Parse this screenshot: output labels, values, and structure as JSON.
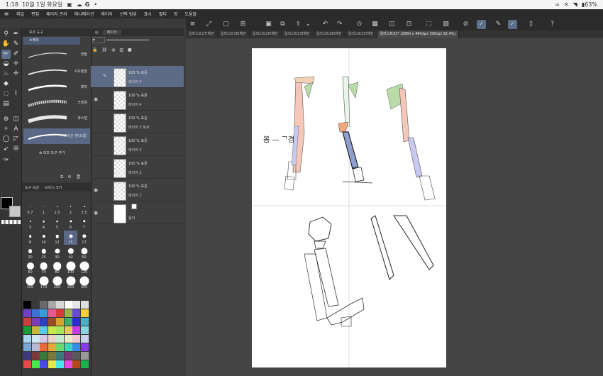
{
  "status": {
    "time": "1:18",
    "date": "10월 1일 화요일",
    "battery": "63%"
  },
  "menu": [
    "파일",
    "편집",
    "페이지 관리",
    "애니메이션",
    "레이어",
    "선택 범위",
    "표시",
    "필터",
    "창",
    "도움말"
  ],
  "brush_panel": {
    "tab": "보조 도구",
    "header": "스케치",
    "brushes": [
      {
        "label": "연필"
      },
      {
        "label": "샤프펜슬"
      },
      {
        "label": "매직"
      },
      {
        "label": "크레용"
      },
      {
        "label": "파스텔"
      },
      {
        "label": "초크"
      },
      {
        "label": "부드러운 펜(흐름)"
      }
    ],
    "add_sub_tool": "보조 도구 추가"
  },
  "size_panel": {
    "tabs": [
      "도구 속성",
      "브러시 크기"
    ],
    "sizes": [
      "0.7",
      "1",
      "1.5",
      "2",
      "2.5",
      "3",
      "4",
      "5",
      "6",
      "7",
      "8",
      "10",
      "12",
      "15",
      "17",
      "20",
      "25",
      "30",
      "40",
      "50",
      "60",
      "70",
      "80",
      "100",
      "120",
      "150",
      "170",
      "200",
      "250",
      "300"
    ],
    "selected": "15"
  },
  "palette_colors": [
    "#000000",
    "#3a3a3a",
    "#6a6a6a",
    "#a8a8a8",
    "#d8d8d8",
    "#ffffff",
    "#e7e7e7",
    "#dedede",
    "#6e42c1",
    "#3e6fd4",
    "#3a9ad9",
    "#e35a91",
    "#d83a3a",
    "#9ab34a",
    "#6b4bd4",
    "#f5d03a",
    "#c94040",
    "#7a3fb0",
    "#2e3fbf",
    "#9a4c2a",
    "#d7a22a",
    "#3fae6b",
    "#2a2ad4",
    "#4ab0c9",
    "#1a9c3a",
    "#c6b83a",
    "#5ac8e8",
    "#c9e84a",
    "#a8e85a",
    "#e8c85a",
    "#c83ae8",
    "#8ad4e8",
    "#a8d4f0",
    "#d0e8f0",
    "#d4c8e8",
    "#e8d4c8",
    "#c8e8d4",
    "#e8e8c8",
    "#f0c8d0",
    "#c8d0f0",
    "#7aa6d8",
    "#b8b8d8",
    "#e86a3a",
    "#e8a83a",
    "#6ad86a",
    "#3ad8b8",
    "#3a8ae8",
    "#8a3ae8",
    "#3a3a7a",
    "#7a3a3a",
    "#3a7a3a",
    "#7a7a3a",
    "#3a7a7a",
    "#7a3a7a",
    "#5a5a5a",
    "#9a9a9a",
    "#e84a4a",
    "#4ae84a",
    "#4a4ae8",
    "#e8e84a",
    "#4ae8e8",
    "#e84ae8",
    "#b04a1a",
    "#1ab04a"
  ],
  "layers": [
    {
      "blend": "100 % 표준",
      "name": "레이어 5",
      "visible": false,
      "selected": true,
      "editing": true
    },
    {
      "blend": "100 % 표준",
      "name": "레이어 4",
      "visible": true,
      "selected": false
    },
    {
      "blend": "100 % 표준",
      "name": "레이어 3 복사",
      "visible": false,
      "selected": false
    },
    {
      "blend": "100 % 표준",
      "name": "레이어 3",
      "visible": false,
      "selected": false
    },
    {
      "blend": "100 % 표준",
      "name": "레이어 2",
      "visible": false,
      "selected": false
    },
    {
      "blend": "100 % 표준",
      "name": "레이어 1",
      "visible": true,
      "selected": false
    },
    {
      "blend": "",
      "name": "용지",
      "visible": true,
      "selected": false,
      "paper": true
    }
  ],
  "layer_panel": {
    "tabs": [
      "",
      "레이어"
    ],
    "blend_mode": "표준",
    "opacity": "100"
  },
  "doc_tabs": [
    "일러스트17(해진",
    "일러스트16(해진",
    "일러스트25(해진",
    "일러스트23(해진",
    "일러스트28(해진",
    "일러스트33(해진",
    "일러스트31* (2960 x 4842px 300dpi 32.4%)"
  ],
  "active_doc_tab": 6
}
